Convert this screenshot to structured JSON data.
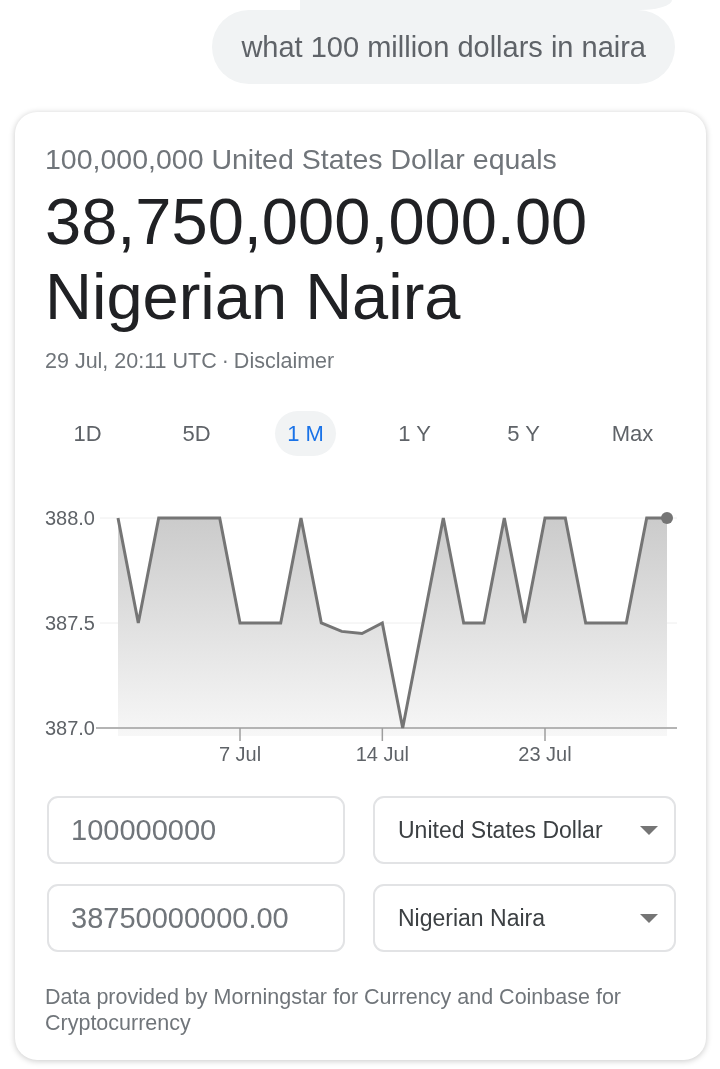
{
  "query": {
    "text": "what 100 million dollars in naira"
  },
  "converter": {
    "summary": "100,000,000 United States Dollar equals",
    "result_amount": "38,750,000,000.00",
    "result_currency": "Nigerian Naira",
    "timestamp": "29 Jul, 20:11 UTC",
    "separator": "·",
    "disclaimer_link": "Disclaimer",
    "ranges": [
      {
        "label": "1D",
        "selected": false
      },
      {
        "label": "5D",
        "selected": false
      },
      {
        "label": "1 M",
        "selected": true
      },
      {
        "label": "1 Y",
        "selected": false
      },
      {
        "label": "5 Y",
        "selected": false
      },
      {
        "label": "Max",
        "selected": false
      }
    ],
    "chart_data": {
      "type": "area",
      "categories": [
        null,
        null,
        null,
        null,
        null,
        null,
        "7 Jul",
        null,
        null,
        null,
        null,
        null,
        null,
        "14 Jul",
        null,
        null,
        null,
        null,
        null,
        null,
        null,
        "23 Jul",
        null,
        null,
        null,
        null,
        null,
        null
      ],
      "series": [
        {
          "color": "#757575",
          "values": [
            388.0,
            387.5,
            388.0,
            388.0,
            388.0,
            388.0,
            387.5,
            387.5,
            387.5,
            388.0,
            387.5,
            387.46,
            387.45,
            387.5,
            387.0,
            387.5,
            388.0,
            387.5,
            387.5,
            388.0,
            387.5,
            388.0,
            388.0,
            387.5,
            387.5,
            387.5,
            388.0,
            388.0
          ]
        }
      ],
      "ylim": [
        387.0,
        388.0
      ],
      "yticks": [
        {
          "value": 387.0,
          "label": "387.0"
        },
        {
          "value": 387.5,
          "label": "387.5"
        },
        {
          "value": 388.0,
          "label": "388.0"
        }
      ]
    },
    "amount_fields": [
      {
        "value": "100000000",
        "currency": "United States Dollar"
      },
      {
        "value": "38750000000.00",
        "currency": "Nigerian Naira"
      }
    ],
    "attribution": "Data provided by Morningstar for Currency and Coinbase for Cryptocurrency"
  }
}
